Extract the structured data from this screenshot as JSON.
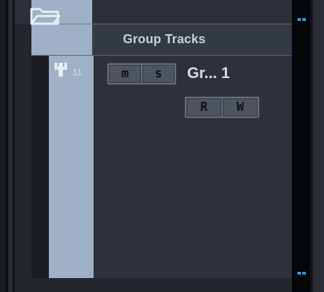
{
  "folder": {
    "label": "Group Tracks",
    "icon": "folder-icon"
  },
  "track": {
    "number": "11",
    "icon": "group-track-icon",
    "name": "Gr... 1",
    "buttons": {
      "mute": "m",
      "solo": "s",
      "read": "R",
      "write": "W"
    }
  },
  "colors": {
    "track_color": "#9fb1c6",
    "panel": "#2d323a",
    "accent": "#1ca4ff",
    "button": "#4e5560"
  }
}
